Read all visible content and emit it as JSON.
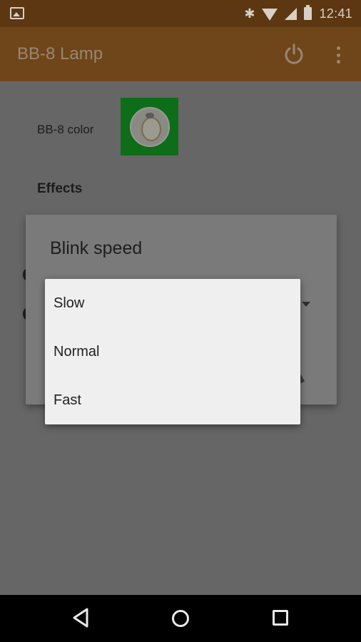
{
  "status_bar": {
    "time": "12:41",
    "icons": [
      "image-notification-icon",
      "bluetooth-icon",
      "wifi-icon",
      "signal-icon",
      "battery-icon"
    ]
  },
  "app_bar": {
    "title": "BB-8 Lamp",
    "actions": [
      "power-icon",
      "overflow-menu-icon"
    ]
  },
  "settings": {
    "color_label": "BB-8 color",
    "color_swatch": "#0e6d18",
    "effects_heading": "Effects"
  },
  "dialog": {
    "title": "Blink speed",
    "options": [
      "Slow",
      "Normal",
      "Fast"
    ]
  },
  "nav_bar": {
    "buttons": [
      "back-icon",
      "home-icon",
      "recents-icon"
    ]
  },
  "colors": {
    "status_bar": "#5c3711",
    "app_bar": "#6f4619",
    "scrim_background": "#666666",
    "dropdown_background": "#efefef"
  }
}
